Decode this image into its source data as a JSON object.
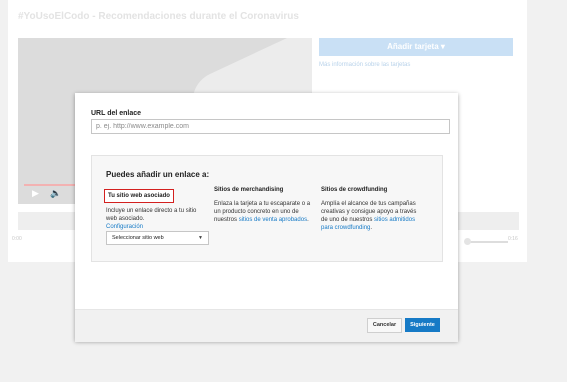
{
  "background": {
    "video_title": "#YoUsoElCodo - Recomendaciones durante el Coronavirus",
    "add_card_label": "Añadir tarjeta",
    "more_info_link": "Más información sobre las tarjetas",
    "time_start": "0:00",
    "time_end": "0:16"
  },
  "dialog": {
    "url_label": "URL del enlace",
    "url_placeholder": "p. ej. http://www.example.com",
    "url_value": "",
    "options_title": "Puedes añadir un enlace a:",
    "columns": [
      {
        "heading": "Tu sitio web asociado",
        "text": "Incluye un enlace directo a tu sitio web asociado.",
        "link": "Configuración",
        "selected": true
      },
      {
        "heading": "Sitios de merchandising",
        "text": "Enlaza la tarjeta a tu escaparate o a un producto concreto en uno de nuestros",
        "link": "sitios de venta aprobados",
        "suffix": "."
      },
      {
        "heading": "Sitios de crowdfunding",
        "text": "Amplía el alcance de tus campañas creativas y consigue apoyo a través de uno de nuestros",
        "link": "sitios admitidos para crowdfunding",
        "suffix": "."
      }
    ],
    "select_label": "Seleccionar sitio web",
    "cancel_label": "Cancelar",
    "next_label": "Siguiente"
  },
  "colors": {
    "accent": "#167ac6",
    "highlight_border": "#d3201f",
    "add_card_bg": "#c9e0f5"
  },
  "icons": {
    "play": "play-icon",
    "volume": "volume-icon",
    "dropdown": "caret-down-icon"
  }
}
